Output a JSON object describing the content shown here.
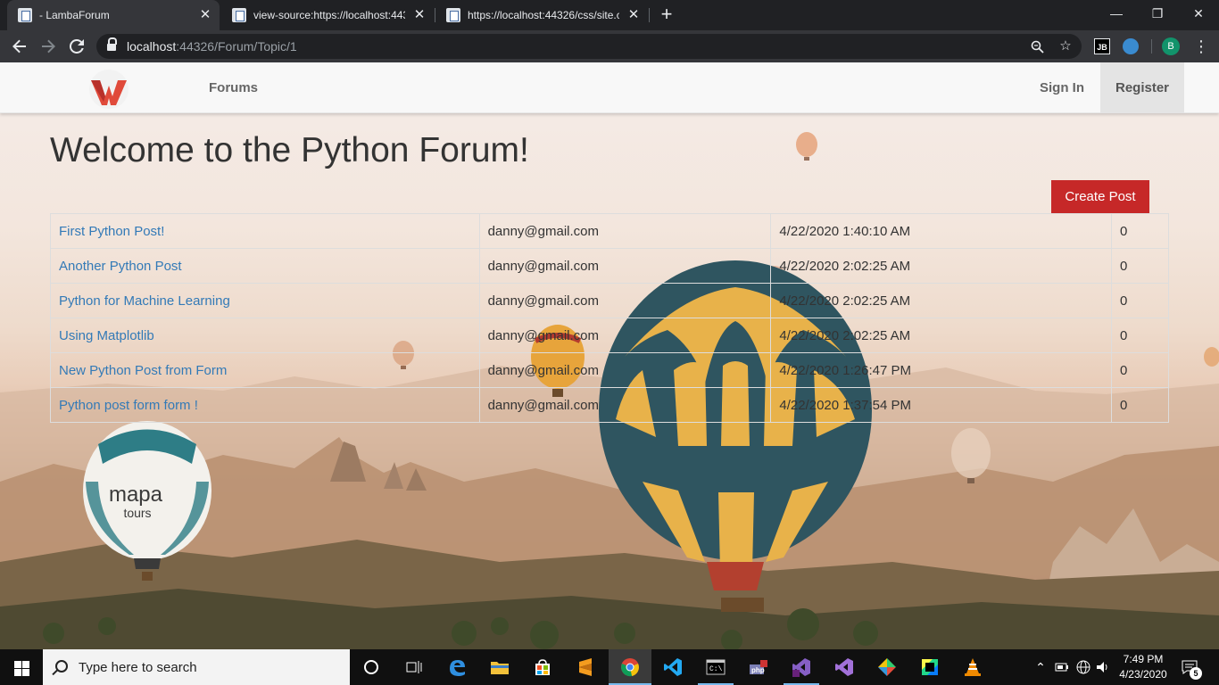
{
  "browser": {
    "tabs": [
      {
        "title": " - LambaForum",
        "active": true
      },
      {
        "title": "view-source:https://localhost:443",
        "active": false
      },
      {
        "title": "https://localhost:44326/css/site.c",
        "active": false
      }
    ],
    "tab_close_glyph": "✕",
    "new_tab_glyph": "+",
    "window_controls": {
      "minimize": "—",
      "maximize": "❐",
      "close": "✕"
    },
    "address": {
      "host": "localhost",
      "port": ":44326",
      "path": "/Forum/Topic/1"
    },
    "extensions": {
      "jb_label": "JB",
      "avatar_initial": "B"
    }
  },
  "site": {
    "nav": {
      "forums": "Forums",
      "sign_in": "Sign In",
      "register": "Register"
    },
    "page_title": "Welcome to the Python Forum!",
    "create_post_label": "Create Post",
    "posts": [
      {
        "title": "First Python Post!",
        "author": "danny@gmail.com",
        "date": "4/22/2020 1:40:10 AM",
        "replies": "0"
      },
      {
        "title": "Another Python Post",
        "author": "danny@gmail.com",
        "date": "4/22/2020 2:02:25 AM",
        "replies": "0"
      },
      {
        "title": "Python for Machine Learning",
        "author": "danny@gmail.com",
        "date": "4/22/2020 2:02:25 AM",
        "replies": "0"
      },
      {
        "title": "Using Matplotlib",
        "author": "danny@gmail.com",
        "date": "4/22/2020 2:02:25 AM",
        "replies": "0"
      },
      {
        "title": "New Python Post from Form",
        "author": "danny@gmail.com",
        "date": "4/22/2020 1:26:47 PM",
        "replies": "0"
      },
      {
        "title": "Python post form form !",
        "author": "danny@gmail.com",
        "date": "4/22/2020 1:37:54 PM",
        "replies": "0"
      }
    ],
    "background_balloon_text": {
      "brand": "mapa",
      "sub": "tours"
    }
  },
  "taskbar": {
    "search_placeholder": "Type here to search",
    "apps": [
      "task-view",
      "edge",
      "file-explorer",
      "store",
      "sublime-text",
      "chrome",
      "vscode",
      "terminal",
      "php",
      "visual-studio",
      "visual-studio-preview",
      "sourcetree",
      "jetbrains-toolbox",
      "vlc"
    ],
    "clock_time": "7:49 PM",
    "clock_date": "4/23/2020",
    "notification_count": "5"
  },
  "colors": {
    "browser_frame": "#202124",
    "browser_toolbar": "#35363a",
    "navbar_bg": "#f8f8f8",
    "link_blue": "#337ab7",
    "create_post_red": "#c62828",
    "avatar_green": "#12936b",
    "taskbar_bg": "#101010"
  }
}
